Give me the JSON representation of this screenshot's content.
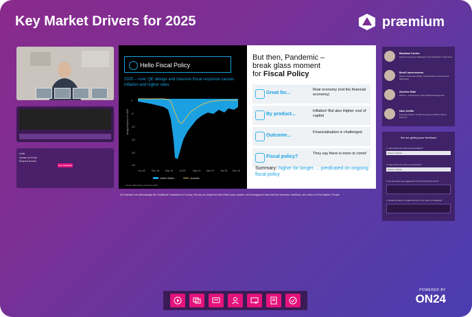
{
  "header": {
    "title": "Key Market Drivers for 2025",
    "brand": "præmium"
  },
  "left_panel": {
    "form_lines": [
      "Invite",
      "Update an Email",
      "Request Access"
    ],
    "button_label": "Free Certificate"
  },
  "slide": {
    "left_title": "Hello Fiscal Policy",
    "subtitle": "2020 – now: QE deluge and massive fiscal response causes inflation and higher rates",
    "y_axis_label": "Budget Balance % GDP",
    "x_ticks": [
      "Jun 18",
      "Nov 18",
      "Sep 19",
      "Jul 20",
      "May 21",
      "Mar 22",
      "Jan 23",
      "Nov 23"
    ],
    "y_ticks": [
      "0",
      "-5",
      "-10",
      "-15",
      "-20",
      "-25"
    ],
    "legend": [
      "United States",
      "Australia"
    ],
    "source": "Source: Bloomberg, February 2024",
    "right_heading_line1": "But then, Pandemic –",
    "right_heading_line2": "break glass moment",
    "right_heading_line3_prefix": "for ",
    "right_heading_line3_bold": "Fiscal Policy",
    "rows": [
      {
        "key": "Great for...",
        "value": "Real economy (not the financial economy)"
      },
      {
        "key": "By product...",
        "value": "Inflation! But also Higher cost of capital"
      },
      {
        "key": "Outcome...",
        "value": "Financialisation is challenged"
      },
      {
        "key": "Fiscal policy?",
        "value": "They say there is more to come!"
      }
    ],
    "summary_prefix": "Summary: ",
    "summary_highlight": "higher for longer…. predicated on ongoing fiscal policy"
  },
  "acknowledgement": "At Praemium we acknowledge the Traditional Custodians of Country. We pay our respect to their Elders past, present, and emerging for they hold the memories, traditions, and culture of First Nations' People.",
  "speakers": [
    {
      "name": "Bautista Cortes",
      "role": "Head of Investment Managers and Distribution, Praemium"
    },
    {
      "name": "Brett Laurenceson",
      "role": "Senior Investment Officer, Global Head of Investments, Macquarie"
    },
    {
      "name": "Andrew Dale",
      "role": "Partner – Investments, CGP Wealth Management"
    },
    {
      "name": "Nick Griffin",
      "role": "Founding Partner & Chief Investment Officer, Munro Partners"
    }
  ],
  "feedback": {
    "heading": "We are getting your feedback",
    "q1": "1. How would you rate the presentation?",
    "q2": "2. How would you rate our presenters?",
    "q3": "3. Do you have any suggestions for improving this event?",
    "q4": "4. Would you like to contact the firm or be more of a webinar?",
    "select_placeholder": "Select a Choice"
  },
  "toolbar": {
    "icons": [
      "media-player-icon",
      "slides-icon",
      "presentation-icon",
      "speaker-bio-icon",
      "certificate-icon",
      "resources-icon",
      "survey-icon"
    ]
  },
  "footer": {
    "powered_by": "POWERED BY",
    "logo": "ON24"
  },
  "colors": {
    "accent": "#e4137c",
    "blue": "#1ba1e2",
    "purple": "#7a2f95"
  }
}
